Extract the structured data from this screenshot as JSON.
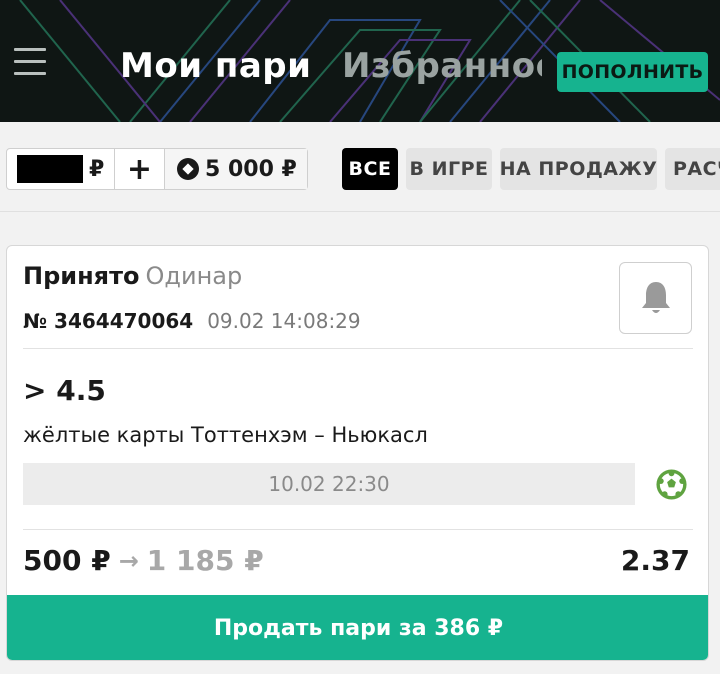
{
  "header": {
    "menu_icon": "hamburger-icon",
    "tab_active": "Мои пари",
    "tab_inactive": "Избранное",
    "topup_label": "ПОПОЛНИТЬ"
  },
  "wallet": {
    "currency": "₽",
    "plus_label": "+",
    "bonus_icon": "bonus-coin-icon",
    "bonus_amount": "5 000 ₽"
  },
  "filters": [
    "ВСЕ",
    "В ИГРЕ",
    "НА ПРОДАЖУ",
    "РАСЧ"
  ],
  "bet": {
    "status": "Принято",
    "type": "Одинар",
    "number": "№ 3464470064",
    "placed_at": "09.02 14:08:29",
    "outcome": "> 4.5",
    "market": "жёлтые карты Тоттенхэм – Ньюкасл",
    "event_time": "10.02 22:30",
    "sport_icon": "football-icon",
    "bell_icon": "bell-icon",
    "stake": "500 ₽",
    "arrow": "→",
    "payout": "1 185 ₽",
    "coefficient": "2.37",
    "sell_label": "Продать пари за 386 ₽"
  },
  "colors": {
    "accent": "#16b38f",
    "header_bg": "#0f1614"
  }
}
